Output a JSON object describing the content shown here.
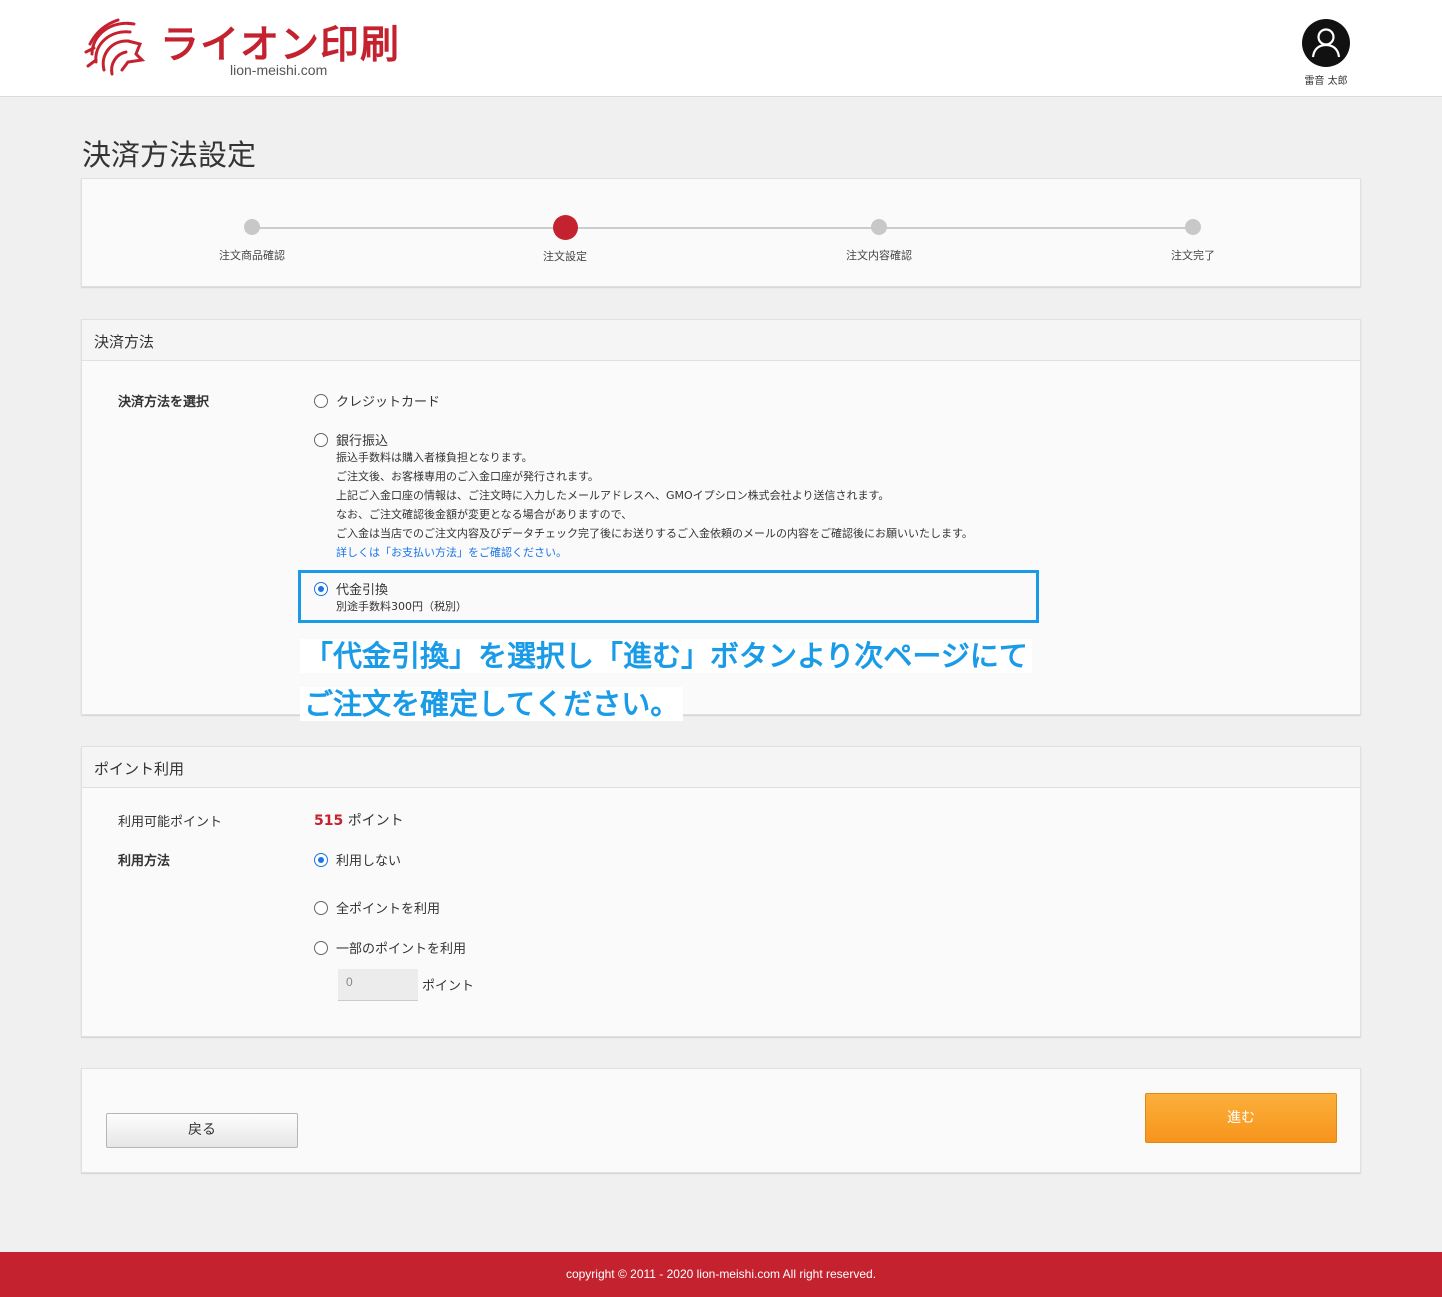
{
  "header": {
    "brand_name": "ライオン印刷",
    "brand_domain": "lion-meishi.com",
    "brand_color": "#c4222f",
    "avatar_icon": "user-icon",
    "user_name": "雷音 太郎"
  },
  "page_title": "決済方法設定",
  "steps": [
    {
      "label": "注文商品確認",
      "active": false
    },
    {
      "label": "注文設定",
      "active": true
    },
    {
      "label": "注文内容確認",
      "active": false
    },
    {
      "label": "注文完了",
      "active": false
    }
  ],
  "payment": {
    "section_title": "決済方法",
    "field_label": "決済方法を選択",
    "options": {
      "credit": {
        "label": "クレジットカード",
        "selected": false
      },
      "bank": {
        "label": "銀行振込",
        "selected": false,
        "desc": [
          "振込手数料は購入者様負担となります。",
          "ご注文後、お客様専用のご入金口座が発行されます。",
          "上記ご入金口座の情報は、ご注文時に入力したメールアドレスへ、GMOイプシロン株式会社より送信されます。",
          "なお、ご注文確認後金額が変更となる場合がありますので、",
          "ご入金は当店でのご注文内容及びデータチェック完了後にお送りするご入金依頼のメールの内容をご確認後にお願いいたします。"
        ],
        "link": "詳しくは「お支払い方法」をご確認ください。"
      },
      "cod": {
        "label": "代金引換",
        "selected": true,
        "desc": "別途手数料300円（税別）"
      }
    }
  },
  "callout": {
    "line1": "「代金引換」を選択し「進む」ボタンより次ページにて",
    "line2": "ご注文を確定してください。",
    "color": "#1a9be8"
  },
  "points": {
    "section_title": "ポイント利用",
    "available_label": "利用可能ポイント",
    "available_value": "515",
    "unit": "ポイント",
    "method_label": "利用方法",
    "options": [
      {
        "label": "利用しない",
        "selected": true
      },
      {
        "label": "全ポイントを利用",
        "selected": false
      },
      {
        "label": "一部のポイントを利用",
        "selected": false
      }
    ],
    "input_value": "0",
    "input_unit": "ポイント"
  },
  "actions": {
    "back_label": "戻る",
    "next_label": "進む",
    "next_color": "#f7941d"
  },
  "footer": {
    "copyright": "copyright © 2011 - 2020 lion-meishi.com All right reserved."
  }
}
